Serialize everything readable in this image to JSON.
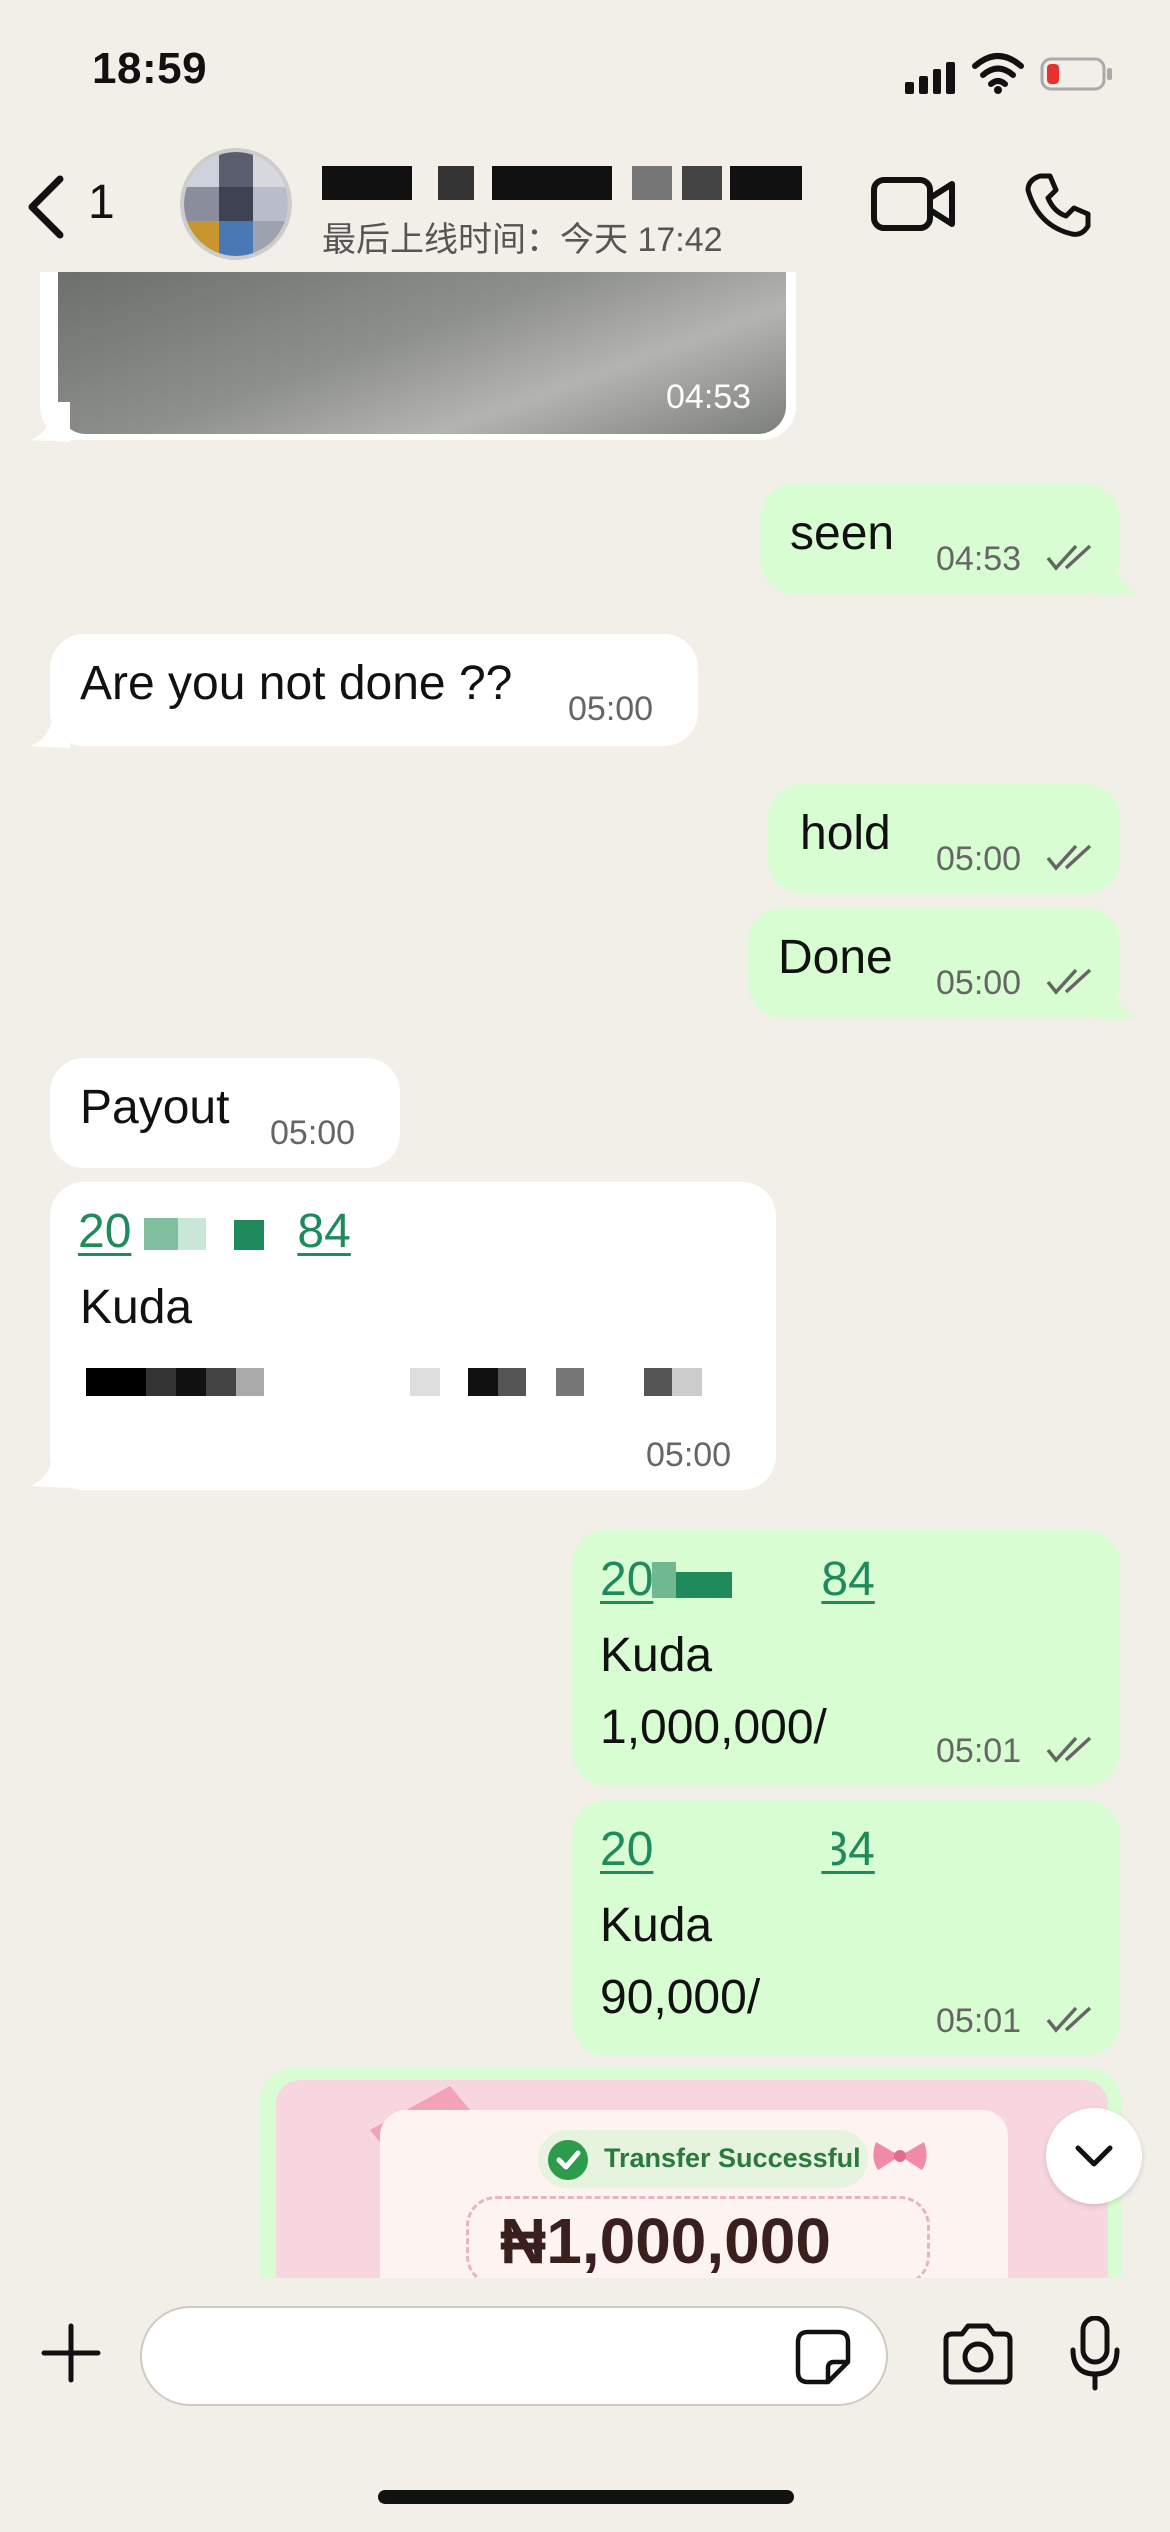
{
  "status_bar": {
    "time": "18:59"
  },
  "header": {
    "back_count": "1",
    "last_seen": "最后上线时间：今天 17:42"
  },
  "messages": [
    {
      "dir": "in",
      "kind": "video",
      "time": "04:53"
    },
    {
      "dir": "out",
      "text": "seen",
      "time": "04:53",
      "status": "read"
    },
    {
      "dir": "in",
      "text": "Are you not done ??",
      "time": "05:00"
    },
    {
      "dir": "out",
      "text": "hold",
      "time": "05:00",
      "status": "read"
    },
    {
      "dir": "out",
      "text": "Done",
      "time": "05:00",
      "status": "read"
    },
    {
      "dir": "in",
      "text": "Payout",
      "time": "05:00"
    },
    {
      "dir": "in",
      "link_start": "20",
      "link_end": "84",
      "line2": "Kuda",
      "time": "05:00"
    },
    {
      "dir": "out",
      "link_start": "20",
      "link_end": "84",
      "line2": "Kuda",
      "line3": "1,000,000/",
      "time": "05:01",
      "status": "read"
    },
    {
      "dir": "out",
      "link_start": "20",
      "link_end": "34",
      "line2": "Kuda",
      "line3": "90,000/",
      "time": "05:01",
      "status": "read"
    }
  ],
  "receipt": {
    "status": "Transfer Successful",
    "amount": "₦1,000,000"
  },
  "colors": {
    "outgoing_bubble": "#d9fdd3",
    "incoming_bubble": "#ffffff",
    "background": "#f2efe9",
    "link": "#1f8a5b"
  },
  "icons": [
    "back-icon",
    "video-call-icon",
    "voice-call-icon",
    "double-check-icon",
    "chevron-down-icon",
    "plus-icon",
    "sticker-icon",
    "camera-icon",
    "microphone-icon"
  ]
}
